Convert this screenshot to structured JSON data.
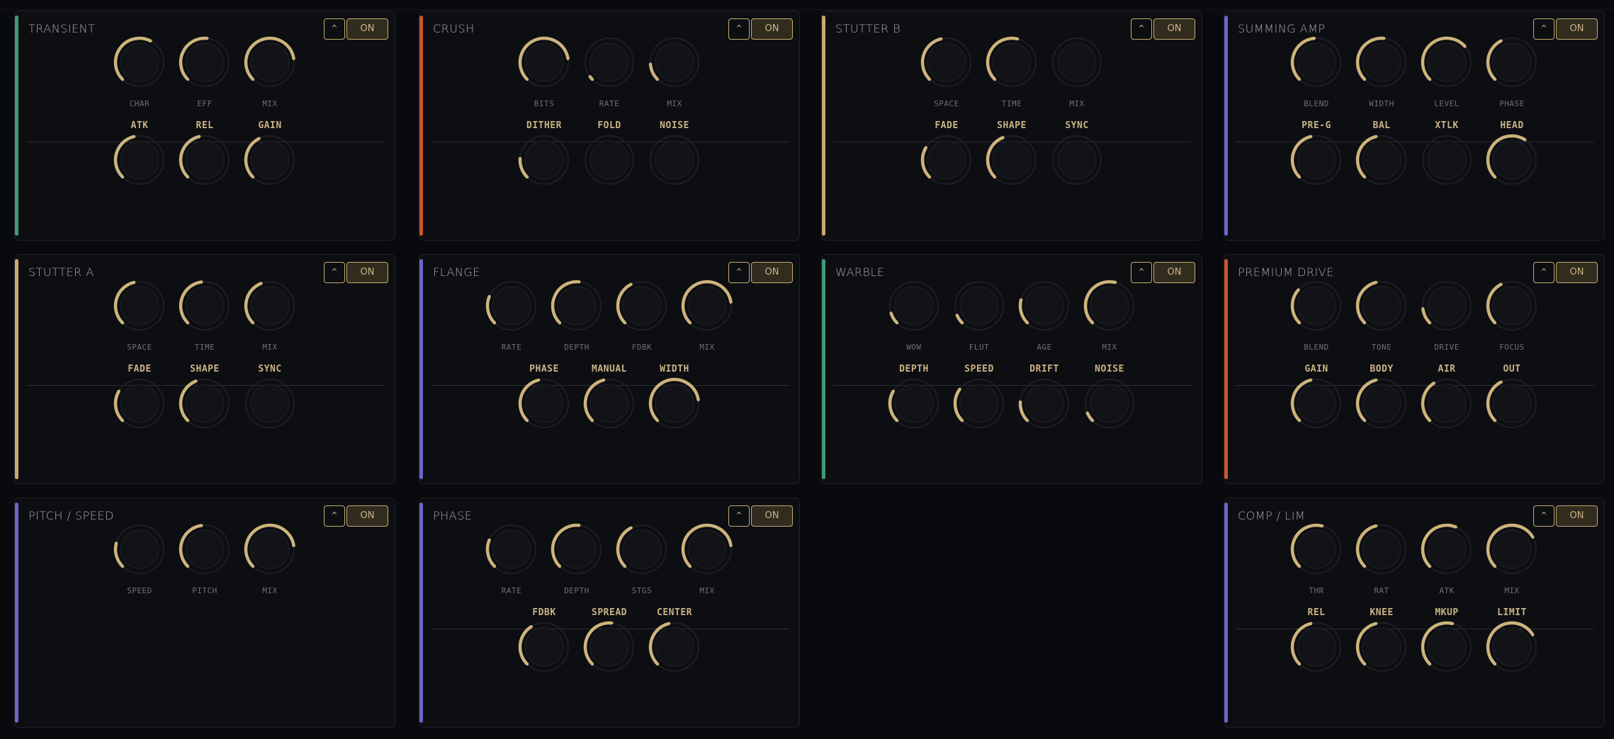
{
  "colors": {
    "background": "#090a0e",
    "panel": "#0d0e12",
    "accent_gold": "#cdb47c",
    "knob_track": "#1d1f24",
    "knob_face": "#121317",
    "stripe_green": "#3f9a76",
    "stripe_orange": "#c8552e",
    "stripe_gold": "#c9a86e",
    "stripe_purple": "#6d64c9"
  },
  "icons": {
    "collapse": "chevron-up-icon"
  },
  "panels": [
    {
      "id": "transient",
      "title": "TRANSIENT",
      "stripe": "green",
      "collapse_label": "^",
      "power_label": "ON",
      "top_knobs": [
        {
          "label": "CHAR",
          "value": 0.6
        },
        {
          "label": "EFF",
          "value": 0.52
        },
        {
          "label": "MIX",
          "value": 0.8
        }
      ],
      "bottom_knobs": [
        {
          "label": "ATK",
          "value": 0.45
        },
        {
          "label": "REL",
          "value": 0.45
        },
        {
          "label": "GAIN",
          "value": 0.4
        }
      ]
    },
    {
      "id": "crush",
      "title": "CRUSH",
      "stripe": "orange",
      "collapse_label": "^",
      "power_label": "ON",
      "top_knobs": [
        {
          "label": "BITS",
          "value": 0.8
        },
        {
          "label": "RATE",
          "value": 0.03
        },
        {
          "label": "MIX",
          "value": 0.15
        }
      ],
      "bottom_knobs": [
        {
          "label": "DITHER",
          "value": 0.18
        },
        {
          "label": "FOLD",
          "value": 0.0
        },
        {
          "label": "NOISE",
          "value": 0.0
        }
      ]
    },
    {
      "id": "stutter-b",
      "title": "STUTTER B",
      "stripe": "gold",
      "collapse_label": "^",
      "power_label": "ON",
      "top_knobs": [
        {
          "label": "SPACE",
          "value": 0.45
        },
        {
          "label": "TIME",
          "value": 0.55
        },
        {
          "label": "MIX",
          "value": 0.0
        }
      ],
      "bottom_knobs": [
        {
          "label": "FADE",
          "value": 0.28
        },
        {
          "label": "SHAPE",
          "value": 0.42
        },
        {
          "label": "SYNC",
          "value": 0.0
        }
      ]
    },
    {
      "id": "summing-amp",
      "title": "SUMMING AMP",
      "stripe": "purple",
      "collapse_label": "^",
      "power_label": "ON",
      "top_knobs": [
        {
          "label": "BLEND",
          "value": 0.48
        },
        {
          "label": "WIDTH",
          "value": 0.52
        },
        {
          "label": "LEVEL",
          "value": 0.68
        },
        {
          "label": "PHASE",
          "value": 0.4
        }
      ],
      "bottom_knobs": [
        {
          "label": "PRE-G",
          "value": 0.45
        },
        {
          "label": "BAL",
          "value": 0.45
        },
        {
          "label": "XTLK",
          "value": 0.0
        },
        {
          "label": "HEAD",
          "value": 0.62
        }
      ]
    },
    {
      "id": "stutter-a",
      "title": "STUTTER A",
      "stripe": "gold",
      "collapse_label": "^",
      "power_label": "ON",
      "top_knobs": [
        {
          "label": "SPACE",
          "value": 0.45
        },
        {
          "label": "TIME",
          "value": 0.47
        },
        {
          "label": "MIX",
          "value": 0.42
        }
      ],
      "bottom_knobs": [
        {
          "label": "FADE",
          "value": 0.28
        },
        {
          "label": "SHAPE",
          "value": 0.42
        },
        {
          "label": "SYNC",
          "value": 0.0
        }
      ]
    },
    {
      "id": "flange",
      "title": "FLANGE",
      "stripe": "purple",
      "collapse_label": "^",
      "power_label": "ON",
      "top_knobs": [
        {
          "label": "RATE",
          "value": 0.25
        },
        {
          "label": "DEPTH",
          "value": 0.52
        },
        {
          "label": "FDBK",
          "value": 0.4
        },
        {
          "label": "MIX",
          "value": 0.8
        }
      ],
      "bottom_knobs": [
        {
          "label": "PHASE",
          "value": 0.45
        },
        {
          "label": "MANUAL",
          "value": 0.45
        },
        {
          "label": "WIDTH",
          "value": 0.8
        }
      ]
    },
    {
      "id": "warble",
      "title": "WARBLE",
      "stripe": "green",
      "collapse_label": "^",
      "power_label": "ON",
      "top_knobs": [
        {
          "label": "WOW",
          "value": 0.1
        },
        {
          "label": "FLUT",
          "value": 0.08
        },
        {
          "label": "AGE",
          "value": 0.22
        },
        {
          "label": "MIX",
          "value": 0.55
        }
      ],
      "bottom_knobs": [
        {
          "label": "DEPTH",
          "value": 0.28
        },
        {
          "label": "SPEED",
          "value": 0.3
        },
        {
          "label": "DRIFT",
          "value": 0.18
        },
        {
          "label": "NOISE",
          "value": 0.08
        }
      ]
    },
    {
      "id": "premium-drive",
      "title": "PREMIUM DRIVE",
      "stripe": "orange",
      "collapse_label": "^",
      "power_label": "ON",
      "top_knobs": [
        {
          "label": "BLEND",
          "value": 0.32
        },
        {
          "label": "TONE",
          "value": 0.45
        },
        {
          "label": "DRIVE",
          "value": 0.14
        },
        {
          "label": "FOCUS",
          "value": 0.4
        }
      ],
      "bottom_knobs": [
        {
          "label": "GAIN",
          "value": 0.45
        },
        {
          "label": "BODY",
          "value": 0.45
        },
        {
          "label": "AIR",
          "value": 0.38
        },
        {
          "label": "OUT",
          "value": 0.4
        }
      ]
    },
    {
      "id": "pitch-speed",
      "title": "PITCH / SPEED",
      "stripe": "purple",
      "collapse_label": "^",
      "power_label": "ON",
      "top_knobs": [
        {
          "label": "SPEED",
          "value": 0.22
        },
        {
          "label": "PITCH",
          "value": 0.47
        },
        {
          "label": "MIX",
          "value": 0.8
        }
      ],
      "bottom_knobs": []
    },
    {
      "id": "phase",
      "title": "PHASE",
      "stripe": "purple",
      "collapse_label": "^",
      "power_label": "ON",
      "top_knobs": [
        {
          "label": "RATE",
          "value": 0.25
        },
        {
          "label": "DEPTH",
          "value": 0.52
        },
        {
          "label": "STGS",
          "value": 0.4
        },
        {
          "label": "MIX",
          "value": 0.8
        }
      ],
      "bottom_knobs": [
        {
          "label": "FDBK",
          "value": 0.38
        },
        {
          "label": "SPREAD",
          "value": 0.52
        },
        {
          "label": "CENTER",
          "value": 0.45
        }
      ]
    },
    {
      "id": "comp-lim",
      "title": "COMP / LIM",
      "stripe": "purple",
      "collapse_label": "^",
      "power_label": "ON",
      "top_knobs": [
        {
          "label": "THR",
          "value": 0.55
        },
        {
          "label": "RAT",
          "value": 0.45
        },
        {
          "label": "ATK",
          "value": 0.58
        },
        {
          "label": "MIX",
          "value": 0.72
        }
      ],
      "bottom_knobs": [
        {
          "label": "REL",
          "value": 0.45
        },
        {
          "label": "KNEE",
          "value": 0.45
        },
        {
          "label": "MKUP",
          "value": 0.55
        },
        {
          "label": "LIMIT",
          "value": 0.72
        }
      ]
    }
  ]
}
